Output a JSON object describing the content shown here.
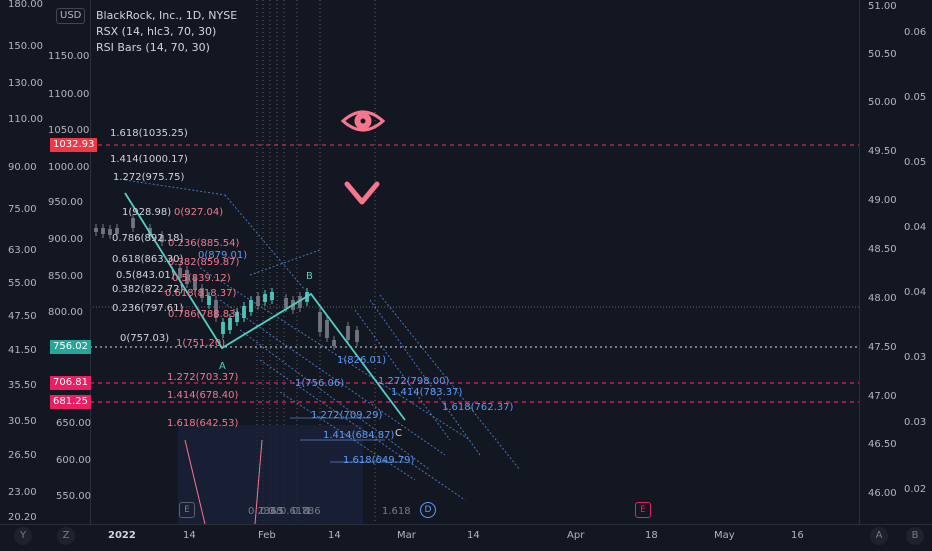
{
  "legend": {
    "title": "BlackRock, Inc., 1D, NYSE",
    "rsx": "RSX (14, hlc3, 70, 30)",
    "rsi_bars": "RSI Bars (14, 70, 30)"
  },
  "currency": "USD",
  "left_axis": [
    "180.00",
    "150.00",
    "130.00",
    "110.00",
    "90.00",
    "75.00",
    "63.00",
    "55.00",
    "47.50",
    "41.50",
    "35.50",
    "30.50",
    "26.50",
    "23.00",
    "20.20"
  ],
  "price_axis": [
    "1150.00",
    "1100.00",
    "1050.00",
    "1000.00",
    "950.00",
    "900.00",
    "850.00",
    "800.00",
    "650.00",
    "600.00",
    "550.00"
  ],
  "right_axis_a": [
    "51.00",
    "50.50",
    "50.00",
    "49.50",
    "49.00",
    "48.50",
    "48.00",
    "47.50",
    "47.00",
    "46.50",
    "46.00"
  ],
  "right_axis_b": [
    "0.06",
    "0.05",
    "0.05",
    "0.04",
    "0.04",
    "0.03",
    "0.03",
    "0.02"
  ],
  "badges": [
    {
      "text": "1032.93",
      "color": "#f23645"
    },
    {
      "text": "756.02",
      "color": "#26a69a"
    },
    {
      "text": "706.81",
      "color": "#e91e63"
    },
    {
      "text": "681.25",
      "color": "#e91e63"
    }
  ],
  "time_axis": [
    "2022",
    "14",
    "Feb",
    "14",
    "Mar",
    "14",
    "Apr",
    "18",
    "May",
    "16"
  ],
  "corner_buttons": [
    "Y",
    "Z",
    "A",
    "B"
  ],
  "fib_upper": [
    "1.618(1035.25)",
    "1.414(1000.17)",
    "1.272(975.75)",
    "1(928.98)",
    "0.786(892.18)",
    "0.618(863.30)",
    "0.5(843.01)",
    "0.382(822.72)",
    "0.236(797.61)",
    "0(757.03)"
  ],
  "fib_pink": [
    "0(927.04)",
    "0.236(885.54)",
    "0.382(859.87)",
    "0(879.01)",
    "0.5(839.12)",
    "0.618(818.37)",
    "0.786(788.83)",
    "1(751.20)"
  ],
  "fib_ext_pink": [
    "1.272(703.37)",
    "1.414(678.40)",
    "1.618(642.53)"
  ],
  "fib_ext_blue": [
    "1(826.01)",
    "1(756.06)",
    "1.272(709.29)",
    "1.414(684.87)",
    "1.618(649.79)",
    "1.272(798.00)",
    "1.414(783.37)",
    "1.618(762.37)"
  ],
  "wave_labels": [
    "A",
    "B",
    "C"
  ],
  "bottom_fib": [
    "0.236",
    "0.38",
    "0.5",
    "0.618",
    "0.786",
    "1",
    "1.618"
  ],
  "event_markers": [
    {
      "text": "E",
      "color": "#5d606b"
    },
    {
      "text": "D",
      "color": "#5b9cf6"
    },
    {
      "text": "E",
      "color": "#e91e63"
    }
  ],
  "accent": {
    "pink": "#f7768e",
    "teal": "#4fd1c5",
    "blue": "#5b9cf6",
    "red": "#f23645"
  },
  "icons": [
    "eye-icon",
    "chevron-down-icon"
  ]
}
